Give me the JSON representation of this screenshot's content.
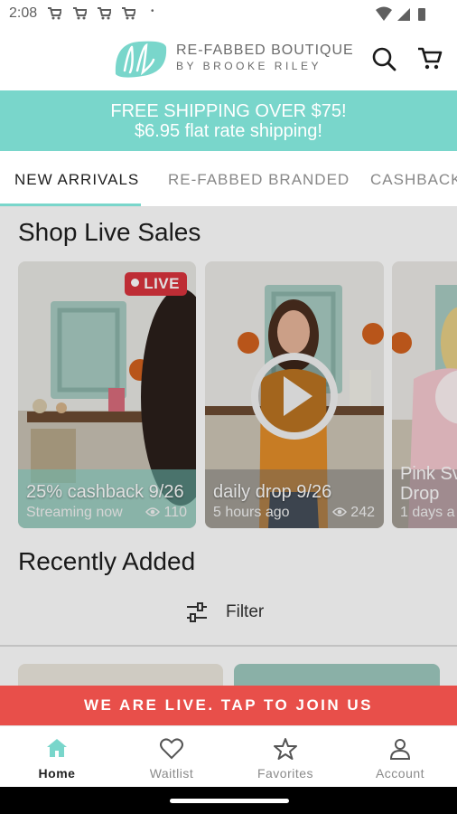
{
  "status_bar": {
    "time": "2:08",
    "dot": "•"
  },
  "header": {
    "brand_line1": "RE-FABBED BOUTIQUE",
    "brand_line2": "BY BROOKE RILEY",
    "accent": "#79d6cb"
  },
  "promo": {
    "line1": "FREE SHIPPING OVER $75!",
    "line2": "$6.95 flat rate shipping!"
  },
  "tabs": [
    {
      "label": "NEW ARRIVALS",
      "active": true
    },
    {
      "label": "RE-FABBED BRANDED",
      "active": false
    },
    {
      "label": "CASHBACK",
      "active": false
    }
  ],
  "live_sales": {
    "title": "Shop Live Sales",
    "cards": [
      {
        "title": "25% cashback 9/26",
        "subtitle": "Streaming now",
        "views": "110",
        "badge": "LIVE"
      },
      {
        "title": "daily drop 9/26",
        "subtitle": "5 hours ago",
        "views": "242"
      },
      {
        "title_line1": "Pink Sv",
        "title_line2": "Drop",
        "subtitle": "1 days a"
      }
    ]
  },
  "recently_added": {
    "title": "Recently Added",
    "filter_label": "Filter"
  },
  "live_banner": {
    "text": "WE ARE LIVE. TAP TO JOIN US",
    "color": "#e84f4a"
  },
  "bottom_nav": [
    {
      "label": "Home",
      "icon": "home-icon",
      "active": true
    },
    {
      "label": "Waitlist",
      "icon": "heart-icon",
      "active": false
    },
    {
      "label": "Favorites",
      "icon": "star-icon",
      "active": false
    },
    {
      "label": "Account",
      "icon": "person-icon",
      "active": false
    }
  ]
}
